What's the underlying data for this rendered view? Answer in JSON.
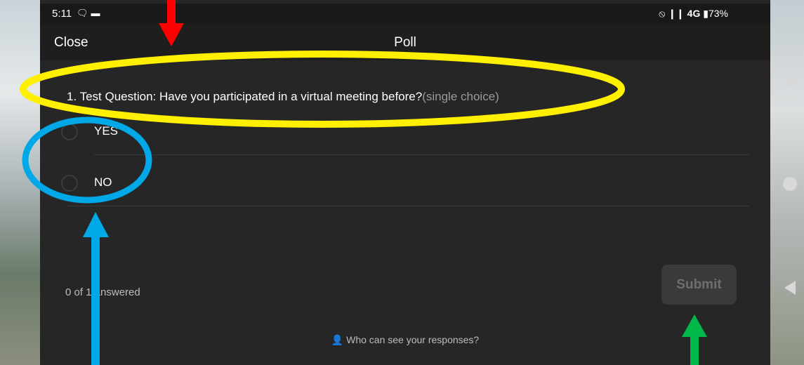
{
  "status_bar": {
    "time": "5:11",
    "left_icons": [
      "chat-icon",
      "video-icon"
    ],
    "right_text": "⦸ .❙❙ 4G 73%",
    "battery": "73%"
  },
  "header": {
    "close_label": "Close",
    "title": "Poll"
  },
  "poll": {
    "question_text": "1. Test Question: Have you participated in a virtual meeting before?",
    "question_hint": "(single choice)",
    "options": [
      {
        "label": "YES",
        "selected": false
      },
      {
        "label": "NO",
        "selected": false
      }
    ],
    "answered_text": "0 of 1 answered",
    "submit_label": "Submit",
    "privacy_text": "Who can see your responses?"
  },
  "colors": {
    "annotation_red": "#ff0000",
    "annotation_yellow": "#ffef00",
    "annotation_blue": "#00a8e8",
    "annotation_green": "#00b74a"
  }
}
